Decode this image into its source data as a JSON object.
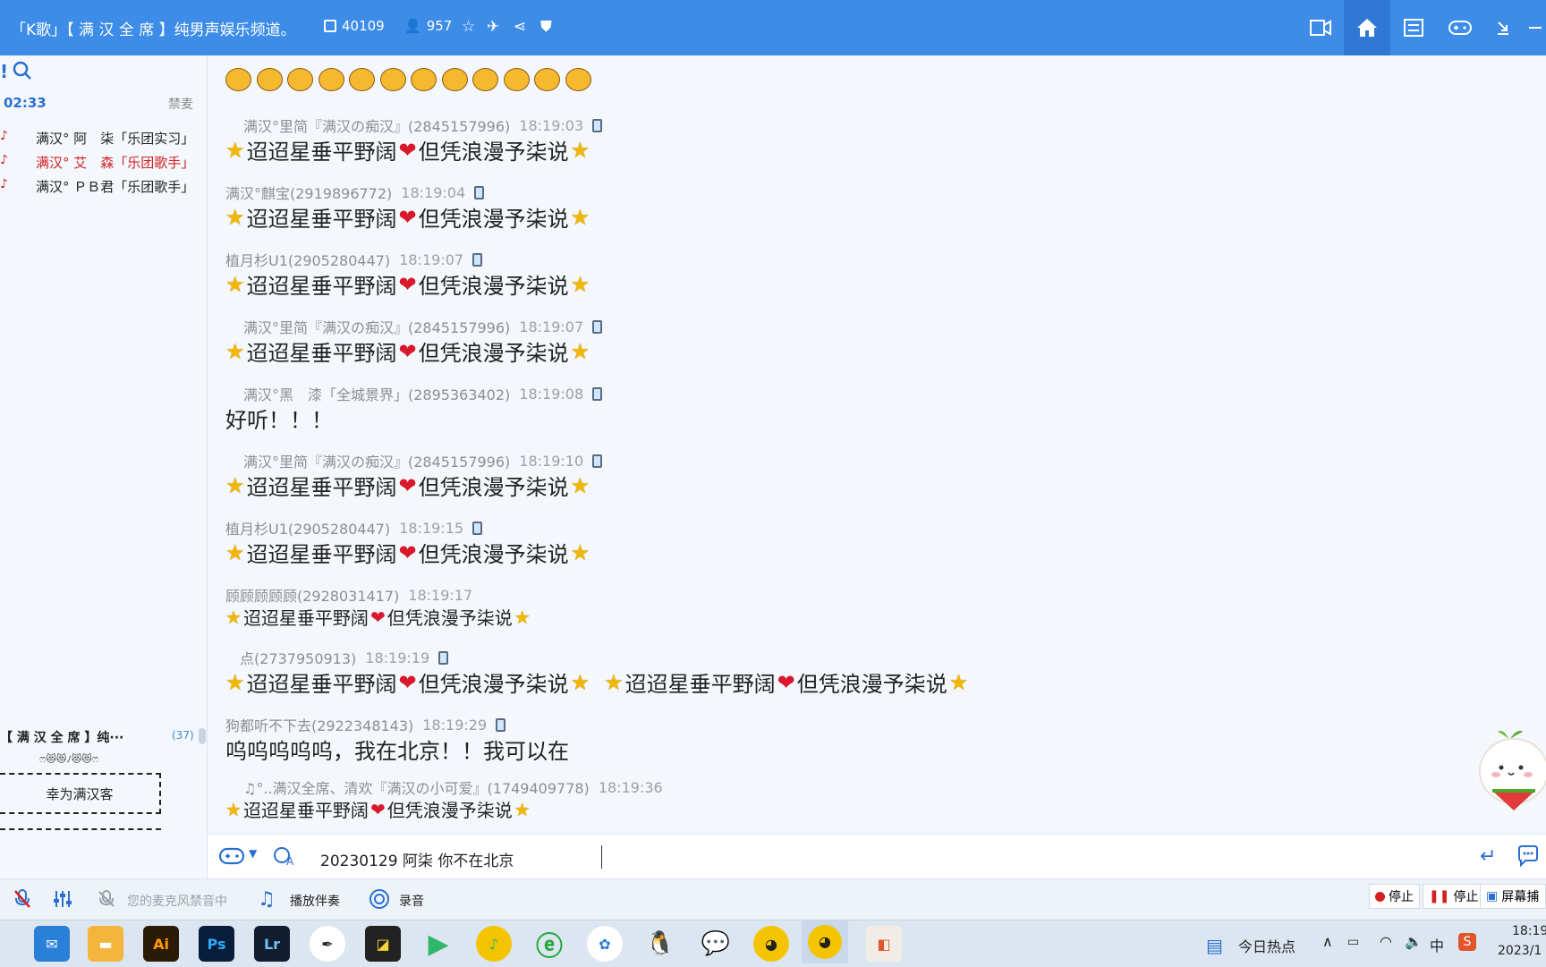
{
  "titlebar": {
    "title": "「K歌」【 满 汉 全 席 】纯男声娱乐频道。",
    "room_id": "40109",
    "online_count": "957"
  },
  "sidebar": {
    "time": "02:33",
    "ban_label": "禁麦",
    "mic_queue": [
      {
        "name": "满汉° 阿　柒「乐团实习」",
        "color": "#222222"
      },
      {
        "name": "满汉° 艾　森「乐团歌手」",
        "color": "#d42020"
      },
      {
        "name": "满汉° ＰＢ君「乐团歌手」",
        "color": "#222222"
      }
    ],
    "channel_name": "【 满 汉 全 席 】纯···",
    "channel_count": "(37)",
    "channel_deco": "ෆ😻😻ﾉ😻😻ෆ",
    "welcome_box": "幸为满汉客"
  },
  "chat": {
    "emoji_row_count": 12,
    "messages": [
      {
        "user": "满汉°里简『满汉の痴汉』(2845157996)",
        "time": "18:19:03",
        "phone": true,
        "text": "迢迢星垂平野阔",
        "text2": "但凭浪漫予柒说",
        "style": "star"
      },
      {
        "user": "满汉°麒宝(2919896772)",
        "time": "18:19:04",
        "phone": true,
        "text": "迢迢星垂平野阔",
        "text2": "但凭浪漫予柒说",
        "style": "star"
      },
      {
        "user": "植月杉U1(2905280447)",
        "time": "18:19:07",
        "phone": true,
        "text": "迢迢星垂平野阔",
        "text2": "但凭浪漫予柒说",
        "style": "star"
      },
      {
        "user": "满汉°里简『满汉の痴汉』(2845157996)",
        "time": "18:19:07",
        "phone": true,
        "text": "迢迢星垂平野阔",
        "text2": "但凭浪漫予柒说",
        "style": "star"
      },
      {
        "user": "满汉°黑　漆「全城景界」(2895363402)",
        "time": "18:19:08",
        "phone": true,
        "text": "好听！！！",
        "style": "plain"
      },
      {
        "user": "满汉°里简『满汉の痴汉』(2845157996)",
        "time": "18:19:10",
        "phone": true,
        "text": "迢迢星垂平野阔",
        "text2": "但凭浪漫予柒说",
        "style": "star"
      },
      {
        "user": "植月杉U1(2905280447)",
        "time": "18:19:15",
        "phone": true,
        "text": "迢迢星垂平野阔",
        "text2": "但凭浪漫予柒说",
        "style": "star"
      },
      {
        "user": "顾顾顾顾顾(2928031417)",
        "time": "18:19:17",
        "phone": false,
        "text": "迢迢星垂平野阔",
        "text2": "但凭浪漫予柒说",
        "style": "star-sm"
      },
      {
        "user": "点(2737950913)",
        "time": "18:19:19",
        "phone": true,
        "text": "迢迢星垂平野阔",
        "text2": "但凭浪漫予柒说",
        "style": "star-double"
      },
      {
        "user": "狗都听不下去(2922348143)",
        "time": "18:19:29",
        "phone": true,
        "text": "呜呜呜呜呜，我在北京！！我可以在",
        "style": "plain"
      },
      {
        "user": "♫°..满汉全席、清欢『满汉の小可爱』(1749409778)",
        "time": "18:19:36",
        "phone": false,
        "text": "迢迢星垂平野阔",
        "text2": "但凭浪漫予柒说",
        "style": "star-sm"
      }
    ]
  },
  "input": {
    "value": "20230129 阿柒 你不在北京"
  },
  "toolbar": {
    "mic_muted": "您的麦克风禁音中",
    "accompany": "播放伴奏",
    "record": "录音",
    "stop1": "停止",
    "stop2": "停止",
    "screen_capture": "屏幕捕"
  },
  "taskbar": {
    "news": "今日热点",
    "ime": "中",
    "clock_time": "18:19",
    "clock_date": "2023/1"
  }
}
